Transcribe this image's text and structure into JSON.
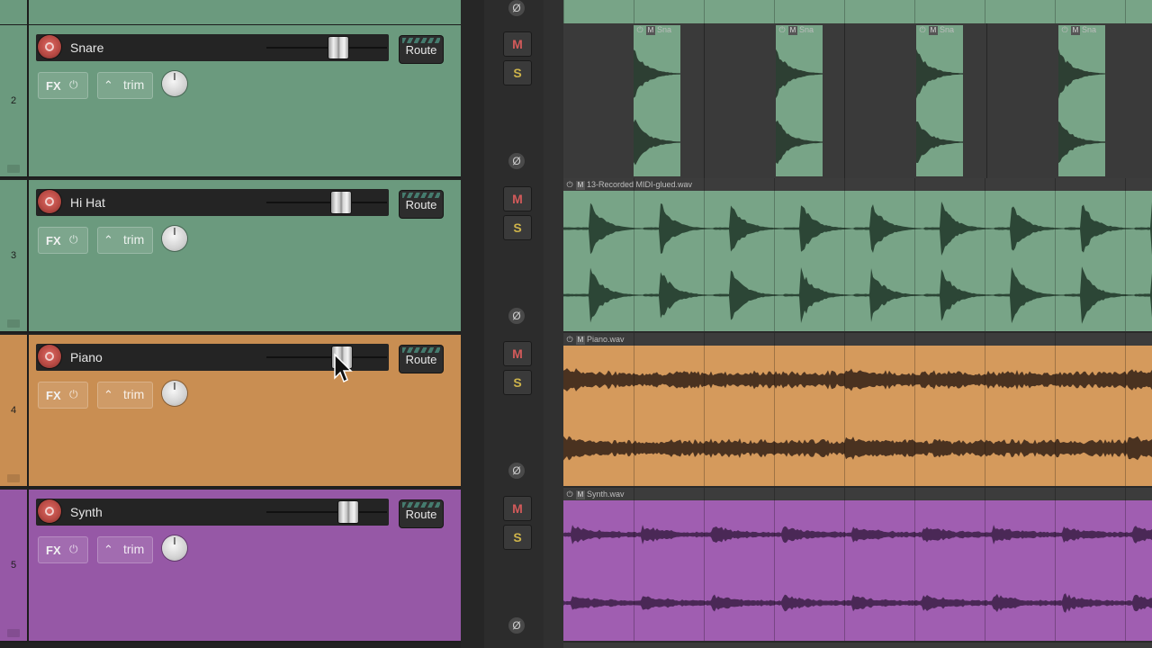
{
  "colors": {
    "green": "#6b9a7e",
    "green_lane": "#78a487",
    "orange": "#c98e52",
    "orange_lane": "#d59a5c",
    "purple": "#9658a6",
    "purple_lane": "#a05eb1",
    "accent_route": "#4b8f7f"
  },
  "top_lane": {
    "color": "#6b9a7e"
  },
  "tracks": [
    {
      "number": "2",
      "name": "Snare",
      "color": "#6b9a7e",
      "volume_fraction": 0.6,
      "armed": true,
      "route_label": "Route",
      "fx_label": "FX",
      "trim_label": "trim",
      "mute_label": "M",
      "solo_label": "S",
      "phase_icon": "phase-invert-icon"
    },
    {
      "number": "3",
      "name": "Hi Hat",
      "color": "#6b9a7e",
      "volume_fraction": 0.62,
      "armed": true,
      "route_label": "Route",
      "fx_label": "FX",
      "trim_label": "trim",
      "mute_label": "M",
      "solo_label": "S",
      "phase_icon": "phase-invert-icon"
    },
    {
      "number": "4",
      "name": "Piano",
      "color": "#c98e52",
      "volume_fraction": 0.63,
      "armed": true,
      "route_label": "Route",
      "fx_label": "FX",
      "trim_label": "trim",
      "mute_label": "M",
      "solo_label": "S",
      "phase_icon": "phase-invert-icon"
    },
    {
      "number": "5",
      "name": "Synth",
      "color": "#9658a6",
      "volume_fraction": 0.68,
      "armed": true,
      "route_label": "Route",
      "fx_label": "FX",
      "trim_label": "trim",
      "mute_label": "M",
      "solo_label": "S",
      "phase_icon": "phase-invert-icon"
    }
  ],
  "lanes": [
    {
      "track": "Snare",
      "items": [
        "Sna",
        "Sna",
        "Sna",
        "Sna"
      ],
      "item_mute_label": "M"
    },
    {
      "track": "Hi Hat",
      "item_name": "13-Recorded MIDI-glued.wav",
      "item_mute_label": "M"
    },
    {
      "track": "Piano",
      "item_name": "Piano.wav",
      "item_mute_label": "M"
    },
    {
      "track": "Synth",
      "item_name": "Synth.wav",
      "item_mute_label": "M"
    }
  ],
  "icons": {
    "record_arm": "record-arm-icon",
    "power": "power-icon",
    "trim_envelope": "envelope-icon",
    "pan": "pan-knob",
    "phase": "phase-invert-icon",
    "cursor": "mouse-pointer-icon"
  },
  "glyphs": {
    "power": "⏻",
    "phase": "Ø",
    "envelope": "⌃"
  }
}
